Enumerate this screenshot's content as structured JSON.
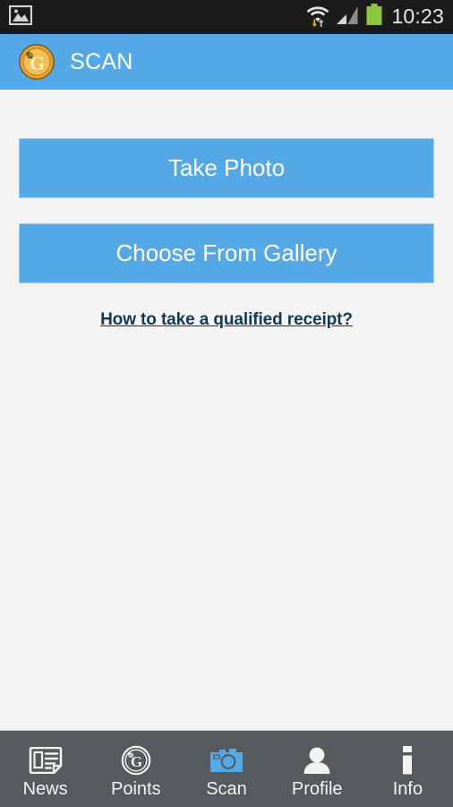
{
  "statusbar": {
    "time": "10:23",
    "left_icons": [
      {
        "name": "gallery-image-icon"
      }
    ],
    "right_icons": [
      {
        "name": "wifi-transfer-icon"
      },
      {
        "name": "cellular-signal-icon"
      },
      {
        "name": "battery-icon"
      }
    ],
    "background_color": "#1b1b1b",
    "battery_color": "#8cc63e"
  },
  "appbar": {
    "title": "SCAN",
    "logo_name": "gold-coin-g-logo",
    "background_color": "#54a8e8",
    "title_color": "#ffffff"
  },
  "main": {
    "background_color": "#f4f4f4",
    "buttons": [
      {
        "label": "Take Photo",
        "name": "take-photo-button"
      },
      {
        "label": "Choose From Gallery",
        "name": "choose-from-gallery-button"
      }
    ],
    "help_link": {
      "label": "How to take a qualified receipt?",
      "color": "#133a52"
    },
    "button_color": "#54a8e6"
  },
  "bottomnav": {
    "background_color": "#555b5c",
    "active_color": "#54a8e6",
    "items": [
      {
        "label": "News",
        "icon": "newspaper-icon",
        "active": false
      },
      {
        "label": "Points",
        "icon": "coin-g-icon",
        "active": false
      },
      {
        "label": "Scan",
        "icon": "camera-icon",
        "active": true
      },
      {
        "label": "Profile",
        "icon": "person-icon",
        "active": false
      },
      {
        "label": "Info",
        "icon": "info-icon",
        "active": false
      }
    ]
  }
}
